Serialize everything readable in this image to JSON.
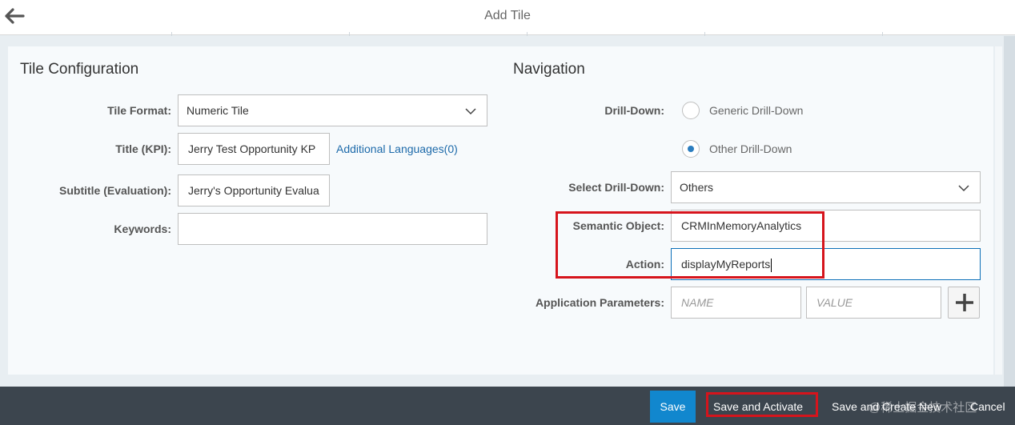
{
  "header": {
    "title": "Add Tile"
  },
  "tile_configuration": {
    "title": "Tile Configuration",
    "tile_format": {
      "label": "Tile Format:",
      "value": "Numeric Tile"
    },
    "title_kpi": {
      "label": "Title (KPI):",
      "value": "Jerry Test Opportunity KP"
    },
    "additional_languages": "Additional Languages(0)",
    "subtitle": {
      "label": "Subtitle (Evaluation):",
      "value": "Jerry's Opportunity Evalua"
    },
    "keywords": {
      "label": "Keywords:",
      "value": ""
    }
  },
  "navigation": {
    "title": "Navigation",
    "drill_down": {
      "label": "Drill-Down:",
      "options": [
        {
          "label": "Generic Drill-Down",
          "selected": false
        },
        {
          "label": "Other Drill-Down",
          "selected": true
        }
      ]
    },
    "select_drill_down": {
      "label": "Select Drill-Down:",
      "value": "Others"
    },
    "semantic_object": {
      "label": "Semantic Object:",
      "value": "CRMInMemoryAnalytics"
    },
    "action": {
      "label": "Action:",
      "value": "displayMyReports"
    },
    "application_parameters": {
      "label": "Application Parameters:",
      "name_placeholder": "NAME",
      "value_placeholder": "VALUE"
    }
  },
  "footer": {
    "save": "Save",
    "save_and_activate": "Save and Activate",
    "save_and_create_new": "Save and Create New",
    "cancel": "Cancel"
  },
  "watermark": "@稀土掘金技术社区",
  "colors": {
    "accent": "#1187ce",
    "link": "#1d6aaa",
    "highlight": "#d6141c",
    "footer_bg": "#3c454e"
  },
  "icons": {
    "back": "arrow-left-icon",
    "dropdown": "chevron-down-icon",
    "add": "plus-icon"
  }
}
